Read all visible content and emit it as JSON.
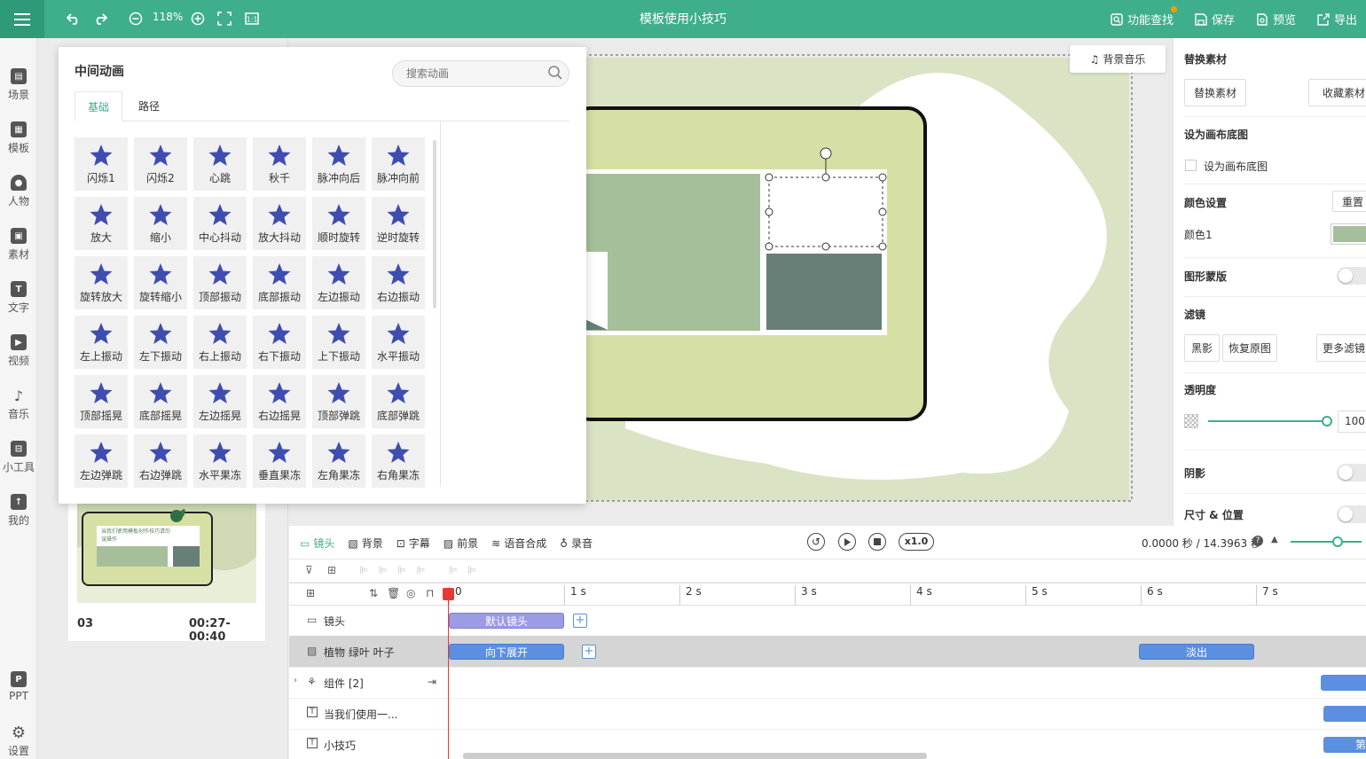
{
  "header": {
    "title": "模板使用小技巧",
    "zoom": "118%",
    "actions": {
      "find": "功能查找",
      "save": "保存",
      "preview": "预览",
      "export": "导出"
    }
  },
  "sidebar": {
    "items": [
      "场景",
      "模板",
      "人物",
      "素材",
      "文字",
      "视频",
      "音乐",
      "小工具",
      "我的"
    ],
    "bottom": [
      "PPT",
      "设置"
    ]
  },
  "scene_card": {
    "index": "03",
    "time_range": "00:27-00:40",
    "thumb_text": "当我们使用模板创作技巧请勿误操作"
  },
  "canvas": {
    "bg_music": "背景音乐"
  },
  "anim_panel": {
    "title": "中间动画",
    "search_placeholder": "搜索动画",
    "tabs": [
      "基础",
      "路径"
    ],
    "items": [
      "闪烁1",
      "闪烁2",
      "心跳",
      "秋千",
      "脉冲向后",
      "脉冲向前",
      "放大",
      "缩小",
      "中心抖动",
      "放大抖动",
      "顺时旋转",
      "逆时旋转",
      "旋转放大",
      "旋转缩小",
      "顶部振动",
      "底部振动",
      "左边振动",
      "右边振动",
      "左上振动",
      "左下振动",
      "右上振动",
      "右下振动",
      "上下振动",
      "水平振动",
      "顶部摇晃",
      "底部摇晃",
      "左边摇晃",
      "右边摇晃",
      "顶部弹跳",
      "底部弹跳",
      "左边弹跳",
      "右边弹跳",
      "水平果冻",
      "垂直果冻",
      "左角果冻",
      "右角果冻"
    ]
  },
  "right_panel": {
    "replace": {
      "title": "替换素材",
      "btn_replace": "替换素材",
      "btn_collect": "收藏素材"
    },
    "canvas_bg": {
      "title": "设为画布底图",
      "checkbox": "设为画布底图"
    },
    "color": {
      "title": "颜色设置",
      "reset": "重置",
      "color1_label": "颜色1",
      "color1": "#a5bf9a"
    },
    "mask": {
      "title": "图形蒙版"
    },
    "filter": {
      "title": "滤镜",
      "bw": "黑影",
      "restore": "恢复原图",
      "more": "更多滤镜"
    },
    "opacity": {
      "title": "透明度",
      "value": "100"
    },
    "shadow": {
      "title": "阴影"
    },
    "size": {
      "title": "尺寸 & 位置"
    }
  },
  "timeline": {
    "tools": [
      "镜头",
      "背景",
      "字幕",
      "前景",
      "语音合成",
      "录音"
    ],
    "speed": "x1.0",
    "time": "0.0000 秒 / 14.3963 秒",
    "ticks": [
      "0",
      "1 s",
      "2 s",
      "3 s",
      "4 s",
      "5 s",
      "6 s",
      "7 s"
    ],
    "tracks": [
      {
        "name": "镜头",
        "clips": [
          "默认镜头"
        ]
      },
      {
        "name": "植物 绿叶 叶子",
        "clips": [
          "向下展开",
          "淡出"
        ]
      },
      {
        "name": "组件 [2]",
        "clips": []
      },
      {
        "name": "当我们使用一...",
        "clips": []
      },
      {
        "name": "小技巧",
        "clips": [
          "第"
        ]
      }
    ]
  }
}
